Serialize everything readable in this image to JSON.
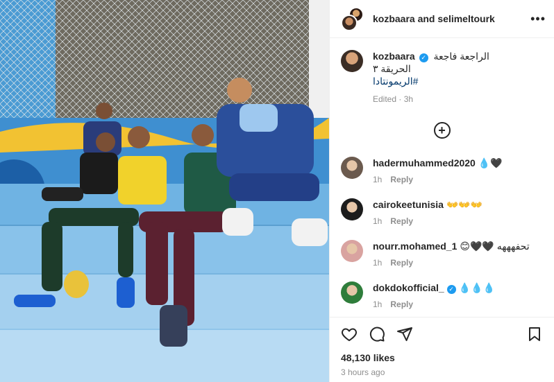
{
  "header": {
    "names": "kozbaara and selimeltourk",
    "more_label": "•••"
  },
  "caption": {
    "username": "kozbaara",
    "line1": "الراجعة فاجعة",
    "line2": "الحريقة ٣",
    "hashtag": "#الريمونتادا",
    "meta": "Edited · 3h"
  },
  "add_comment_label": "+",
  "comments": [
    {
      "user": "hadermuhammed2020",
      "text": "💧🖤",
      "time": "1h",
      "reply": "Reply",
      "avatar_color": "#6b5a4e"
    },
    {
      "user": "cairokeetunisia",
      "text": "👐👐👐",
      "time": "1h",
      "reply": "Reply",
      "avatar_color": "#1c1c1c"
    },
    {
      "user": "nourr.mohamed_1",
      "text": "😊🖤🖤 تحفهههه",
      "time": "1h",
      "reply": "Reply",
      "avatar_color": "#d9a3a0"
    },
    {
      "user": "dokdokofficial_",
      "text": "💧💧💧",
      "time": "1h",
      "reply": "Reply",
      "avatar_color": "#2f7d3b"
    }
  ],
  "footer": {
    "likes": "48,130 likes",
    "ago": "3 hours ago"
  },
  "icons": {
    "like": "heart-icon",
    "comment": "comment-icon",
    "share": "share-icon",
    "save": "bookmark-icon"
  },
  "colors": {
    "verified": "#1d9bf0",
    "hashtag": "#00376b",
    "muted": "#8e8e8e"
  }
}
